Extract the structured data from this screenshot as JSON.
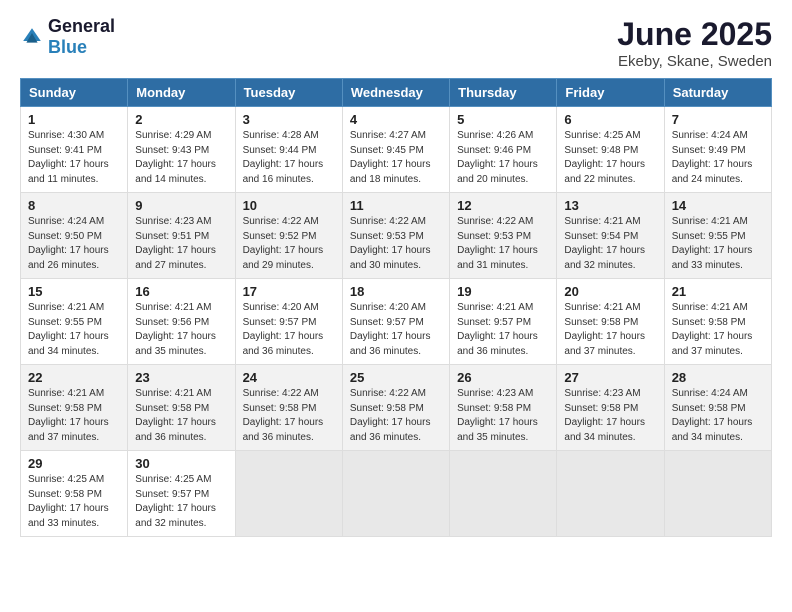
{
  "header": {
    "logo_general": "General",
    "logo_blue": "Blue",
    "title": "June 2025",
    "subtitle": "Ekeby, Skane, Sweden"
  },
  "days_of_week": [
    "Sunday",
    "Monday",
    "Tuesday",
    "Wednesday",
    "Thursday",
    "Friday",
    "Saturday"
  ],
  "weeks": [
    [
      {
        "day": "1",
        "info": "Sunrise: 4:30 AM\nSunset: 9:41 PM\nDaylight: 17 hours\nand 11 minutes."
      },
      {
        "day": "2",
        "info": "Sunrise: 4:29 AM\nSunset: 9:43 PM\nDaylight: 17 hours\nand 14 minutes."
      },
      {
        "day": "3",
        "info": "Sunrise: 4:28 AM\nSunset: 9:44 PM\nDaylight: 17 hours\nand 16 minutes."
      },
      {
        "day": "4",
        "info": "Sunrise: 4:27 AM\nSunset: 9:45 PM\nDaylight: 17 hours\nand 18 minutes."
      },
      {
        "day": "5",
        "info": "Sunrise: 4:26 AM\nSunset: 9:46 PM\nDaylight: 17 hours\nand 20 minutes."
      },
      {
        "day": "6",
        "info": "Sunrise: 4:25 AM\nSunset: 9:48 PM\nDaylight: 17 hours\nand 22 minutes."
      },
      {
        "day": "7",
        "info": "Sunrise: 4:24 AM\nSunset: 9:49 PM\nDaylight: 17 hours\nand 24 minutes."
      }
    ],
    [
      {
        "day": "8",
        "info": "Sunrise: 4:24 AM\nSunset: 9:50 PM\nDaylight: 17 hours\nand 26 minutes."
      },
      {
        "day": "9",
        "info": "Sunrise: 4:23 AM\nSunset: 9:51 PM\nDaylight: 17 hours\nand 27 minutes."
      },
      {
        "day": "10",
        "info": "Sunrise: 4:22 AM\nSunset: 9:52 PM\nDaylight: 17 hours\nand 29 minutes."
      },
      {
        "day": "11",
        "info": "Sunrise: 4:22 AM\nSunset: 9:53 PM\nDaylight: 17 hours\nand 30 minutes."
      },
      {
        "day": "12",
        "info": "Sunrise: 4:22 AM\nSunset: 9:53 PM\nDaylight: 17 hours\nand 31 minutes."
      },
      {
        "day": "13",
        "info": "Sunrise: 4:21 AM\nSunset: 9:54 PM\nDaylight: 17 hours\nand 32 minutes."
      },
      {
        "day": "14",
        "info": "Sunrise: 4:21 AM\nSunset: 9:55 PM\nDaylight: 17 hours\nand 33 minutes."
      }
    ],
    [
      {
        "day": "15",
        "info": "Sunrise: 4:21 AM\nSunset: 9:55 PM\nDaylight: 17 hours\nand 34 minutes."
      },
      {
        "day": "16",
        "info": "Sunrise: 4:21 AM\nSunset: 9:56 PM\nDaylight: 17 hours\nand 35 minutes."
      },
      {
        "day": "17",
        "info": "Sunrise: 4:20 AM\nSunset: 9:57 PM\nDaylight: 17 hours\nand 36 minutes."
      },
      {
        "day": "18",
        "info": "Sunrise: 4:20 AM\nSunset: 9:57 PM\nDaylight: 17 hours\nand 36 minutes."
      },
      {
        "day": "19",
        "info": "Sunrise: 4:21 AM\nSunset: 9:57 PM\nDaylight: 17 hours\nand 36 minutes."
      },
      {
        "day": "20",
        "info": "Sunrise: 4:21 AM\nSunset: 9:58 PM\nDaylight: 17 hours\nand 37 minutes."
      },
      {
        "day": "21",
        "info": "Sunrise: 4:21 AM\nSunset: 9:58 PM\nDaylight: 17 hours\nand 37 minutes."
      }
    ],
    [
      {
        "day": "22",
        "info": "Sunrise: 4:21 AM\nSunset: 9:58 PM\nDaylight: 17 hours\nand 37 minutes."
      },
      {
        "day": "23",
        "info": "Sunrise: 4:21 AM\nSunset: 9:58 PM\nDaylight: 17 hours\nand 36 minutes."
      },
      {
        "day": "24",
        "info": "Sunrise: 4:22 AM\nSunset: 9:58 PM\nDaylight: 17 hours\nand 36 minutes."
      },
      {
        "day": "25",
        "info": "Sunrise: 4:22 AM\nSunset: 9:58 PM\nDaylight: 17 hours\nand 36 minutes."
      },
      {
        "day": "26",
        "info": "Sunrise: 4:23 AM\nSunset: 9:58 PM\nDaylight: 17 hours\nand 35 minutes."
      },
      {
        "day": "27",
        "info": "Sunrise: 4:23 AM\nSunset: 9:58 PM\nDaylight: 17 hours\nand 34 minutes."
      },
      {
        "day": "28",
        "info": "Sunrise: 4:24 AM\nSunset: 9:58 PM\nDaylight: 17 hours\nand 34 minutes."
      }
    ],
    [
      {
        "day": "29",
        "info": "Sunrise: 4:25 AM\nSunset: 9:58 PM\nDaylight: 17 hours\nand 33 minutes."
      },
      {
        "day": "30",
        "info": "Sunrise: 4:25 AM\nSunset: 9:57 PM\nDaylight: 17 hours\nand 32 minutes."
      },
      {
        "day": "",
        "info": ""
      },
      {
        "day": "",
        "info": ""
      },
      {
        "day": "",
        "info": ""
      },
      {
        "day": "",
        "info": ""
      },
      {
        "day": "",
        "info": ""
      }
    ]
  ]
}
